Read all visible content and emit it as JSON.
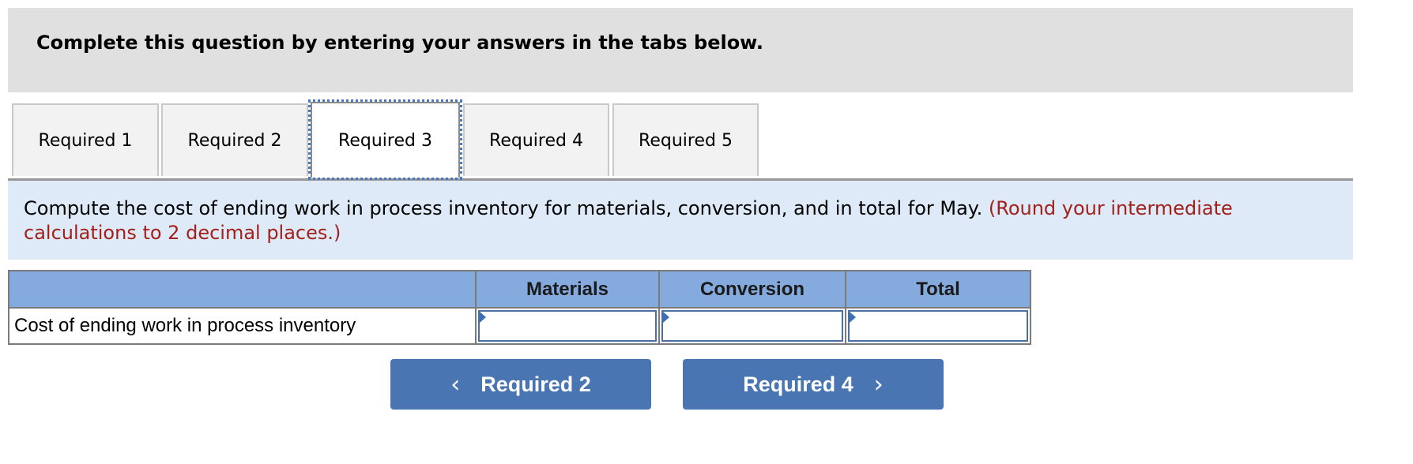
{
  "header": {
    "title": "Complete this question by entering your answers in the tabs below."
  },
  "tabs": [
    {
      "label": "Required 1",
      "active": false
    },
    {
      "label": "Required 2",
      "active": false
    },
    {
      "label": "Required 3",
      "active": true
    },
    {
      "label": "Required 4",
      "active": false
    },
    {
      "label": "Required 5",
      "active": false
    }
  ],
  "instruction": {
    "text": "Compute the cost of ending work in process inventory for materials, conversion, and in total for May.",
    "note": "(Round your intermediate calculations to 2 decimal places.)",
    "note_color": "#a3201a"
  },
  "table": {
    "columns": [
      "",
      "Materials",
      "Conversion",
      "Total"
    ],
    "rows": [
      {
        "label": "Cost of ending work in process inventory",
        "materials": "",
        "conversion": "",
        "total": ""
      }
    ]
  },
  "navigation": {
    "prev_label": "Required 2",
    "prev_icon": "chevron-left-icon",
    "next_label": "Required 4",
    "next_icon": "chevron-right-icon",
    "button_color": "#4a75b3"
  }
}
